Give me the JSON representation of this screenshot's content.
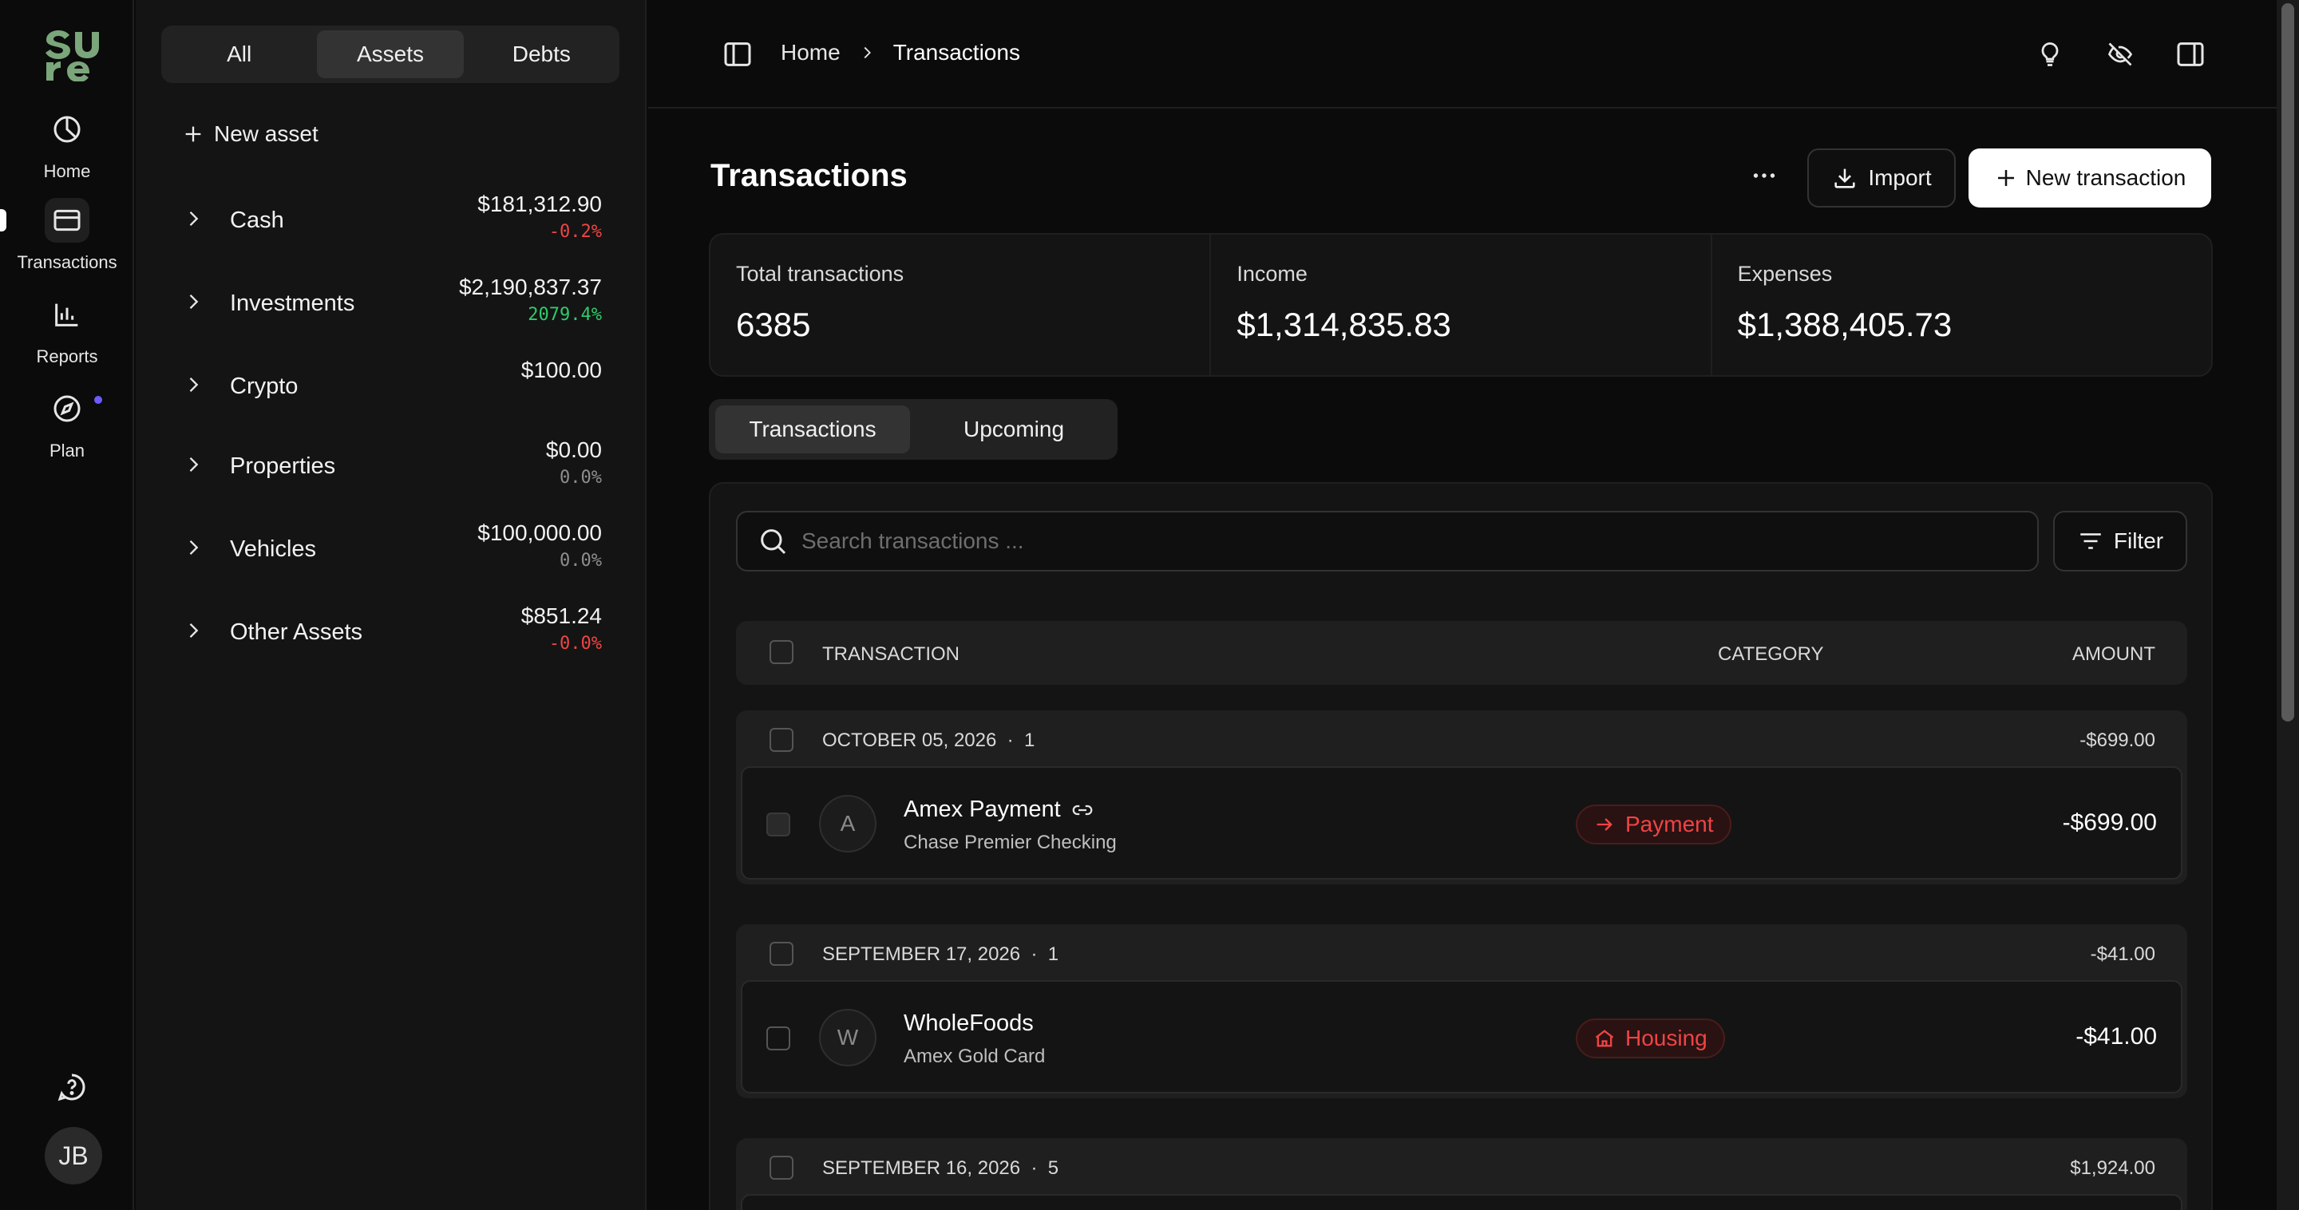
{
  "rail": {
    "logo_text": "sure",
    "items": [
      {
        "label": "Home",
        "icon": "pie-chart-icon"
      },
      {
        "label": "Transactions",
        "icon": "credit-card-icon"
      },
      {
        "label": "Reports",
        "icon": "bar-chart-icon"
      },
      {
        "label": "Plan",
        "icon": "compass-icon"
      }
    ],
    "avatar_initials": "JB"
  },
  "accounts": {
    "segments": [
      "All",
      "Assets",
      "Debts"
    ],
    "selected_segment": "Assets",
    "new_label": "New asset",
    "rows": [
      {
        "name": "Cash",
        "balance": "$181,312.90",
        "change": "-0.2%",
        "tone": "neg"
      },
      {
        "name": "Investments",
        "balance": "$2,190,837.37",
        "change": "2079.4%",
        "tone": "pos"
      },
      {
        "name": "Crypto",
        "balance": "$100.00",
        "change": "",
        "tone": "neu"
      },
      {
        "name": "Properties",
        "balance": "$0.00",
        "change": "0.0%",
        "tone": "neu"
      },
      {
        "name": "Vehicles",
        "balance": "$100,000.00",
        "change": "0.0%",
        "tone": "neu"
      },
      {
        "name": "Other Assets",
        "balance": "$851.24",
        "change": "-0.0%",
        "tone": "neg"
      }
    ]
  },
  "topbar": {
    "breadcrumb": [
      "Home",
      "Transactions"
    ]
  },
  "main": {
    "title": "Transactions",
    "import_label": "Import",
    "new_tx_label": "New transaction",
    "stats": [
      {
        "label": "Total transactions",
        "value": "6385"
      },
      {
        "label": "Income",
        "value": "$1,314,835.83"
      },
      {
        "label": "Expenses",
        "value": "$1,388,405.73"
      }
    ],
    "tabs": [
      "Transactions",
      "Upcoming"
    ],
    "selected_tab": "Transactions",
    "search_placeholder": "Search transactions ...",
    "filter_label": "Filter",
    "columns": {
      "transaction": "TRANSACTION",
      "category": "CATEGORY",
      "amount": "AMOUNT"
    },
    "groups": [
      {
        "date": "OCTOBER 05, 2026",
        "count": "1",
        "total": "-$699.00",
        "rows": [
          {
            "initial": "A",
            "name": "Amex Payment",
            "account": "Chase Premier Checking",
            "category": "Payment",
            "category_icon": "arrow-right-icon",
            "amount": "-$699.00",
            "linked": true
          }
        ]
      },
      {
        "date": "SEPTEMBER 17, 2026",
        "count": "1",
        "total": "-$41.00",
        "rows": [
          {
            "initial": "W",
            "name": "WholeFoods",
            "account": "Amex Gold Card",
            "category": "Housing",
            "category_icon": "house-icon",
            "amount": "-$41.00",
            "linked": false
          }
        ]
      },
      {
        "date": "SEPTEMBER 16, 2026",
        "count": "5",
        "total": "$1,924.00",
        "rows": []
      }
    ]
  },
  "colors": {
    "negative": "#f04444",
    "positive": "#2fca6b",
    "accent_dot": "#6d5bff"
  }
}
